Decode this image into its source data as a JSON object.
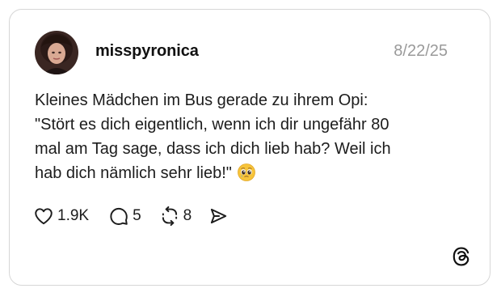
{
  "post": {
    "username": "misspyronica",
    "date": "8/22/25",
    "text_lines": [
      "Kleines Mädchen im Bus gerade zu ihrem Opi:",
      "\"Stört es dich eigentlich, wenn ich dir ungefähr 80",
      "mal am Tag sage, dass ich dich lieb hab? Weil ich",
      "hab dich nämlich sehr lieb!\""
    ],
    "emoji": "pleading-face-emoji"
  },
  "actions": {
    "likes": "1.9K",
    "replies": "5",
    "reposts": "8",
    "icons": [
      "heart-icon",
      "comment-icon",
      "repost-icon",
      "share-icon"
    ]
  },
  "branding": {
    "logo": "threads-logo-icon"
  },
  "colors": {
    "border": "#d6d6d6",
    "text": "#1c1c1c",
    "muted": "#9a9a9a"
  }
}
